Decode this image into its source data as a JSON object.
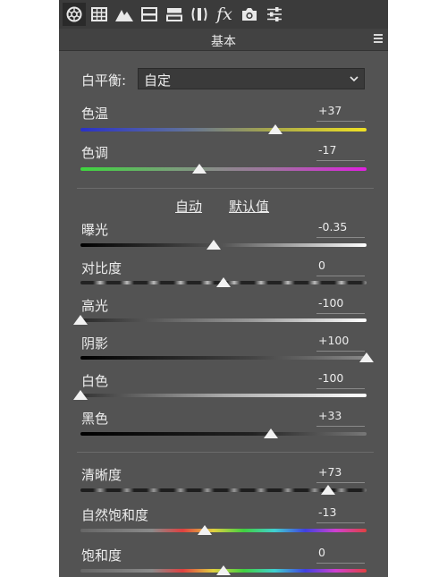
{
  "toolbar": {
    "icons": [
      "aperture-icon",
      "grid-histogram-icon",
      "mountain-icon",
      "split-panel-icon",
      "split-toning-icon",
      "lens-icon",
      "fx-icon",
      "camera-icon",
      "sliders-icon"
    ],
    "fx_label": "fx"
  },
  "header": {
    "title": "基本",
    "menu_icon": "hamburger-menu-icon"
  },
  "white_balance": {
    "label": "白平衡:",
    "value": "自定"
  },
  "sliders": [
    {
      "id": "temperature",
      "label": "色温",
      "value": "+37",
      "position": 0.68
    },
    {
      "id": "tint",
      "label": "色调",
      "value": "-17",
      "position": 0.415
    },
    {
      "id": "exposure",
      "label": "曝光",
      "value": "-0.35",
      "position": 0.465
    },
    {
      "id": "contrast",
      "label": "对比度",
      "value": "0",
      "position": 0.5
    },
    {
      "id": "highlights",
      "label": "高光",
      "value": "-100",
      "position": 0.0
    },
    {
      "id": "shadows",
      "label": "阴影",
      "value": "+100",
      "position": 1.0
    },
    {
      "id": "whites",
      "label": "白色",
      "value": "-100",
      "position": 0.0
    },
    {
      "id": "blacks",
      "label": "黑色",
      "value": "+33",
      "position": 0.665
    },
    {
      "id": "clarity",
      "label": "清晰度",
      "value": "+73",
      "position": 0.865
    },
    {
      "id": "vibrance",
      "label": "自然饱和度",
      "value": "-13",
      "position": 0.435
    },
    {
      "id": "saturation",
      "label": "饱和度",
      "value": "0",
      "position": 0.5
    }
  ],
  "links": {
    "auto": "自动",
    "default": "默认值"
  },
  "colors": {
    "panel_bg": "#535353",
    "toolbar_bg": "#3b3b3b",
    "text": "#ececec",
    "thumb": "#f2f2f2"
  }
}
